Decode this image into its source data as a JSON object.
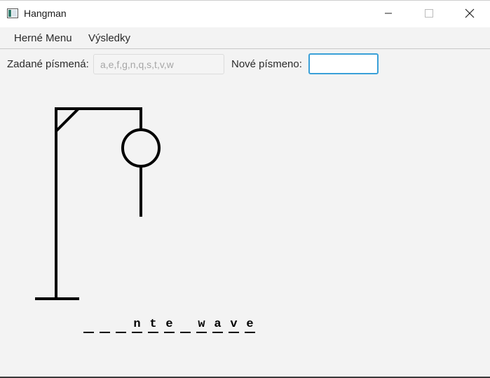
{
  "window": {
    "title": "Hangman",
    "icon": "app-window-icon"
  },
  "menubar": {
    "items": [
      {
        "label": "Herné Menu"
      },
      {
        "label": "Výsledky"
      }
    ]
  },
  "inputs": {
    "entered_label": "Zadané písmená:",
    "entered_placeholder": "a,e,f,g,n,q,s,t,v,w",
    "entered_value": "",
    "new_label": "Nové písmeno:",
    "new_value": ""
  },
  "hangman": {
    "parts_drawn": [
      "base",
      "pole",
      "beam",
      "brace",
      "head",
      "body"
    ]
  },
  "word": {
    "letters": [
      "",
      "",
      "",
      "n",
      "t",
      "e",
      "",
      "w",
      "a",
      "v",
      "e"
    ]
  },
  "colors": {
    "focus_border": "#3aa0d8",
    "drawing": "#000000"
  }
}
